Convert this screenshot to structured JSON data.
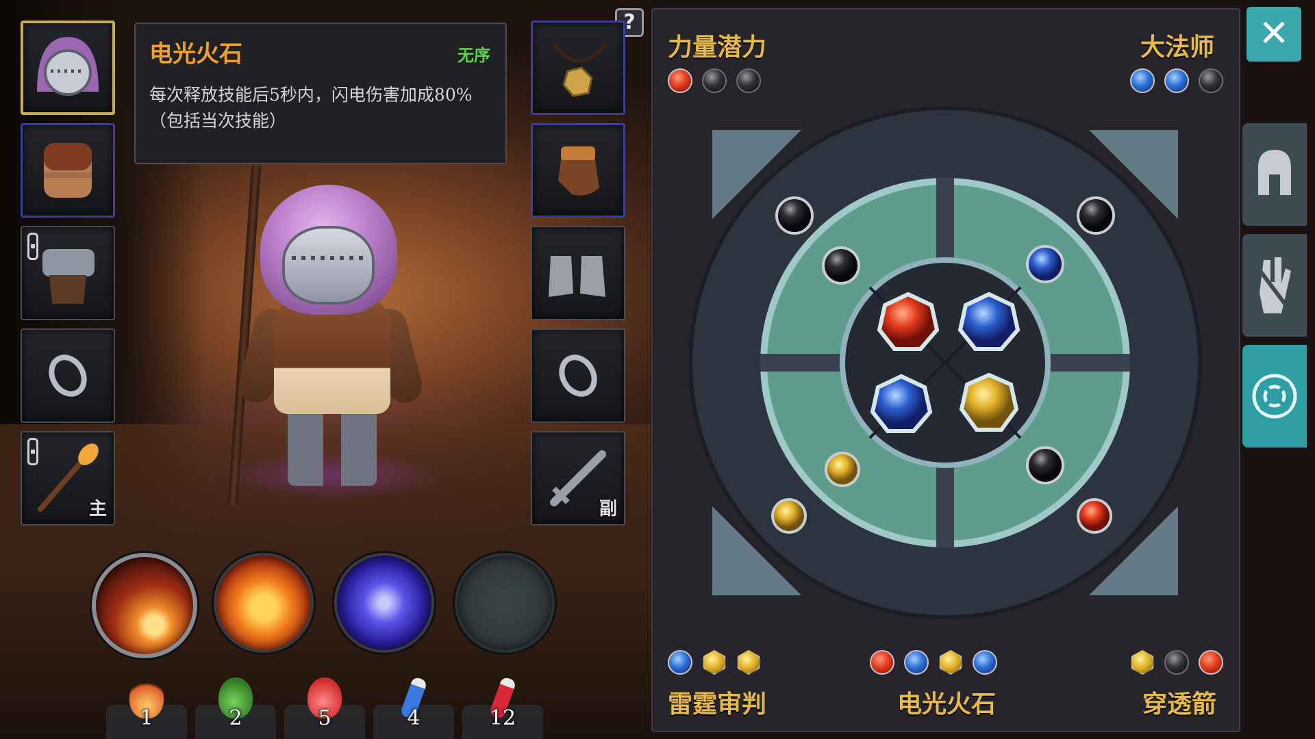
{
  "tooltip": {
    "title": "电光火石",
    "tag": "无序",
    "description": "每次释放技能后5秒内，闪电伤害加成80%（包括当次技能）"
  },
  "equipment_left": [
    {
      "name": "helmet",
      "selected": true
    },
    {
      "name": "armor"
    },
    {
      "name": "pants",
      "locked": true
    },
    {
      "name": "ring-left"
    },
    {
      "name": "weapon-main",
      "locked": true,
      "tag": "主"
    }
  ],
  "equipment_right": [
    {
      "name": "amulet"
    },
    {
      "name": "gloves"
    },
    {
      "name": "boots"
    },
    {
      "name": "ring-right"
    },
    {
      "name": "weapon-off",
      "tag": "副"
    }
  ],
  "skills": [
    {
      "name": "meteor",
      "icon": "meteor-icon"
    },
    {
      "name": "fire-burst",
      "icon": "fire-icon"
    },
    {
      "name": "lightning-orb",
      "icon": "lightning-orb-icon"
    },
    {
      "name": "empty",
      "icon": ""
    }
  ],
  "consumables": [
    {
      "name": "campfire",
      "count": "1",
      "color": "#e0602a"
    },
    {
      "name": "green-potion",
      "count": "2",
      "color": "#4aa83a"
    },
    {
      "name": "red-potion",
      "count": "5",
      "color": "#e03030"
    },
    {
      "name": "blue-vial",
      "count": "4",
      "color": "#3a7ae0"
    },
    {
      "name": "red-vial",
      "count": "12",
      "color": "#d8283a"
    }
  ],
  "panel": {
    "top_left": {
      "label": "力量潜力",
      "gems": [
        "red",
        "dark",
        "dark"
      ]
    },
    "top_right": {
      "label": "大法师",
      "gems": [
        "blue",
        "blue",
        "dark"
      ]
    },
    "bottom_left": {
      "label": "雷霆审判",
      "gems": [
        "blue",
        "gold",
        "gold"
      ]
    },
    "bottom_center": {
      "label": "电光火石",
      "gems": [
        "red",
        "blue",
        "gold",
        "blue"
      ]
    },
    "bottom_right": {
      "label": "穿透箭",
      "gems": [
        "gold",
        "dark",
        "red"
      ]
    },
    "board_center_gems": [
      "red",
      "blue",
      "blue",
      "gold"
    ],
    "board_outer_gems": [
      "dark",
      "dark",
      "blue",
      "dark",
      "gold",
      "gold",
      "dark",
      "red"
    ]
  },
  "side_tabs": [
    "helmet-tab-icon",
    "gloves-tab-icon",
    "gem-board-tab-icon"
  ],
  "colors": {
    "accent": "#3aa7ad",
    "gold_text": "#e5b94a",
    "title_orange": "#f0a12a",
    "tag_green": "#5fcf4f"
  }
}
